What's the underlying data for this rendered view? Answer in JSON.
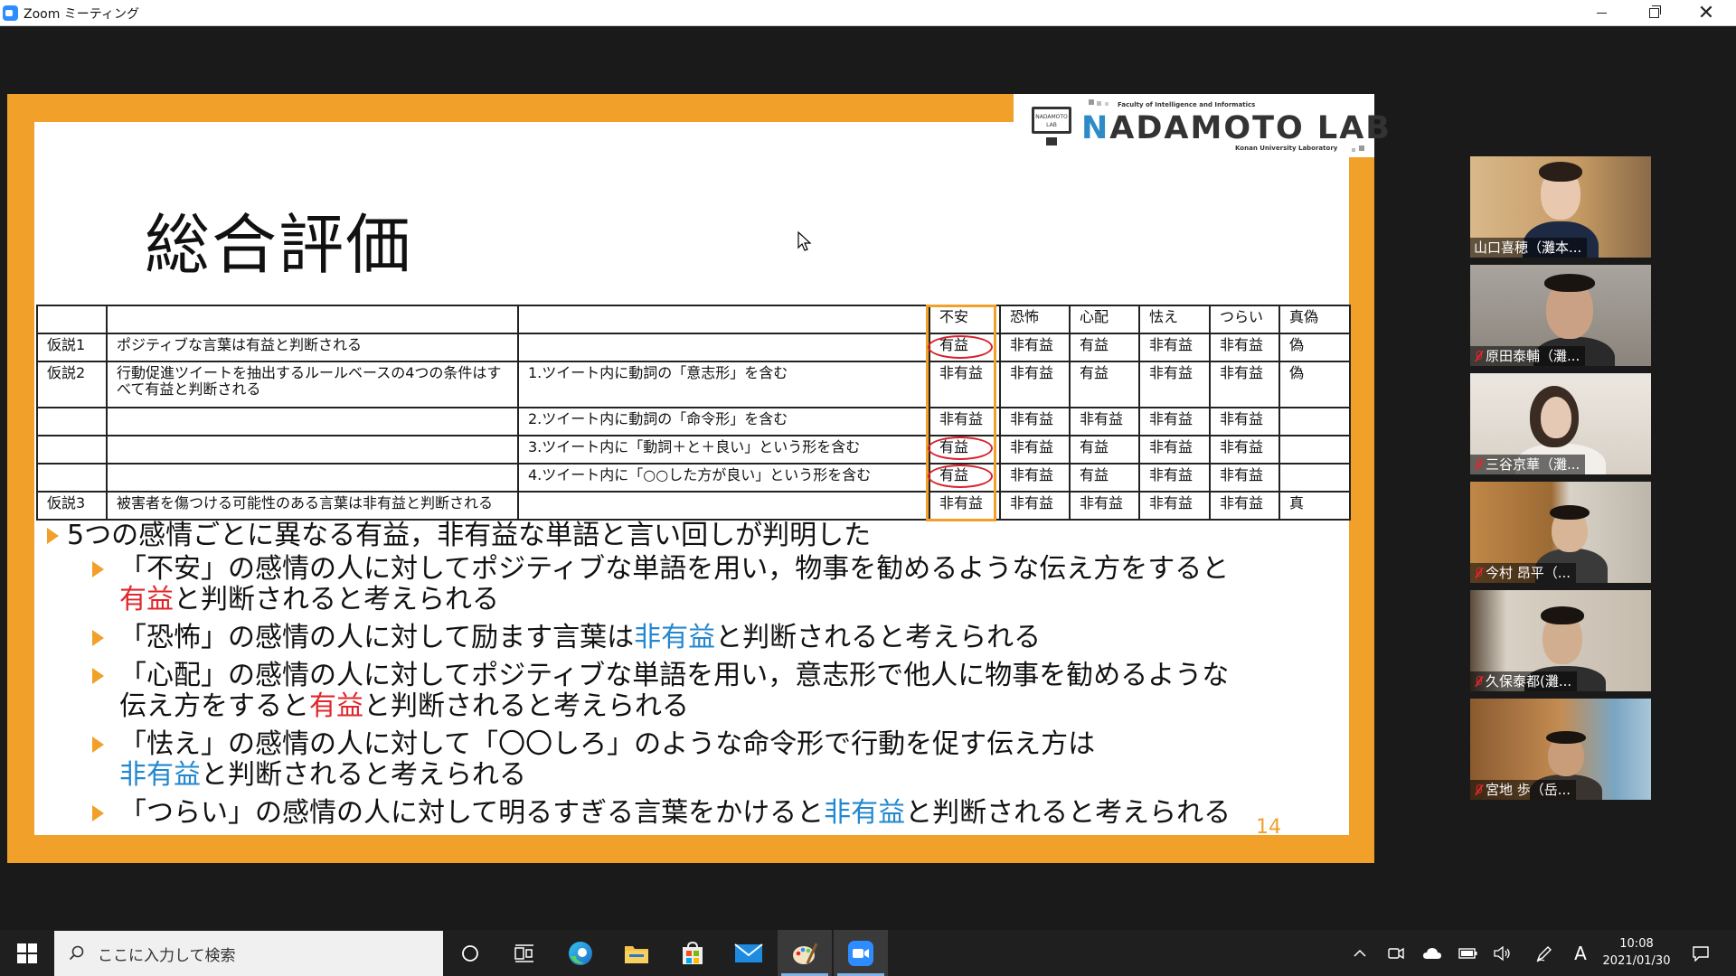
{
  "window": {
    "title": "Zoom ミーティング"
  },
  "slide": {
    "title": "総合評価",
    "logo": {
      "top_text": "Faculty of Intelligence and Informatics",
      "main_first": "N",
      "main_rest": "ADAMOTO LAB",
      "sub_text": "Konan University Laboratory",
      "monitor_text": "NADAMOTO LAB"
    },
    "table": {
      "headers": [
        "",
        "",
        "",
        "不安",
        "恐怖",
        "心配",
        "怯え",
        "つらい",
        "真偽"
      ],
      "rows": [
        [
          "仮説1",
          "ポジティブな言葉は有益と判断される",
          "",
          "有益",
          "非有益",
          "有益",
          "非有益",
          "非有益",
          "偽"
        ],
        [
          "仮説2",
          "行動促進ツイートを抽出するルールベースの4つの条件はすべて有益と判断される",
          "1.ツイート内に動詞の「意志形」を含む",
          "非有益",
          "非有益",
          "有益",
          "非有益",
          "非有益",
          "偽"
        ],
        [
          "",
          "",
          "2.ツイート内に動詞の「命令形」を含む",
          "非有益",
          "非有益",
          "非有益",
          "非有益",
          "非有益",
          ""
        ],
        [
          "",
          "",
          "3.ツイート内に「動詞＋と＋良い」という形を含む",
          "有益",
          "非有益",
          "有益",
          "非有益",
          "非有益",
          ""
        ],
        [
          "",
          "",
          "4.ツイート内に「○○した方が良い」という形を含む",
          "有益",
          "非有益",
          "有益",
          "非有益",
          "非有益",
          ""
        ],
        [
          "仮説3",
          "被害者を傷つける可能性のある言葉は非有益と判断される",
          "",
          "非有益",
          "非有益",
          "非有益",
          "非有益",
          "非有益",
          "真"
        ]
      ]
    },
    "bullets": {
      "main": "5つの感情ごとに異なる有益，非有益な単語と言い回しが判明した",
      "s1_a": "「不安」の感情の人に対してポジティブな単語を用い，物事を勧めるような伝え方をすると",
      "s1_b": "有益",
      "s1_c": "と判断されると考えられる",
      "s2_a": "「恐怖」の感情の人に対して励ます言葉は",
      "s2_b": "非有益",
      "s2_c": "と判断されると考えられる",
      "s3_a": "「心配」の感情の人に対してポジティブな単語を用い，意志形で他人に物事を勧めるような",
      "s3_b": "伝え方をすると",
      "s3_c": "有益",
      "s3_d": "と判断されると考えられる",
      "s4_a": "「怯え」の感情の人に対して「〇〇しろ」のような命令形で行動を促す伝え方は",
      "s4_b": "非有益",
      "s4_c": "と判断されると考えられる",
      "s5_a": "「つらい」の感情の人に対して明るすぎる言葉をかけると",
      "s5_b": "非有益",
      "s5_c": "と判断されると考えられる"
    },
    "page_number": "14"
  },
  "participants": [
    {
      "name": "山口喜穂（灘本...",
      "muted": false
    },
    {
      "name": "原田泰輔（灘...",
      "muted": true
    },
    {
      "name": "三谷京華（灘...",
      "muted": true
    },
    {
      "name": "今村 昂平（...",
      "muted": true
    },
    {
      "name": "久保泰都(灘...",
      "muted": true
    },
    {
      "name": "宮地 歩（岳...",
      "muted": true
    }
  ],
  "taskbar": {
    "search_placeholder": "ここに入力して検索",
    "ime_indicator": "A",
    "time": "10:08",
    "date": "2021/01/30"
  },
  "colors": {
    "accent_orange": "#f1a02a",
    "useful_red": "#e0262b",
    "useless_blue": "#2287cf",
    "zoom_blue": "#2d8cff"
  }
}
